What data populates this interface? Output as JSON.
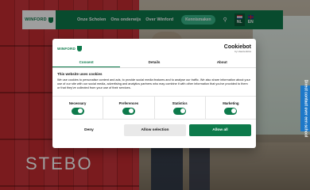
{
  "header": {
    "logo_text": "WINFORD",
    "nav": [
      "Onze Scholen",
      "Ons onderwijs",
      "Over Winford"
    ],
    "cta": "Kennismaken",
    "languages": [
      {
        "code": "NL",
        "active": true
      },
      {
        "code": "EN",
        "active": false
      }
    ]
  },
  "hero": {
    "title": "STEBO"
  },
  "side_tab": "Direct contact over een school",
  "dialog": {
    "logo_text": "WINFORD",
    "brand": "Cookiebot",
    "brand_sub": "by Usercentrics",
    "tabs": [
      "Consent",
      "Details",
      "About"
    ],
    "active_tab": 0,
    "heading": "This website uses cookies",
    "text": "We use cookies to personalise content and ads, to provide social media features and to analyse our traffic. We also share information about your use of our site with our social media, advertising and analytics partners who may combine it with other information that you've provided to them or that they've collected from your use of their services.",
    "toggles": [
      {
        "label": "Necessary",
        "on": true
      },
      {
        "label": "Preferences",
        "on": true
      },
      {
        "label": "Statistics",
        "on": true
      },
      {
        "label": "Marketing",
        "on": true
      }
    ],
    "buttons": {
      "deny": "Deny",
      "selection": "Allow selection",
      "all": "Allow all"
    }
  }
}
